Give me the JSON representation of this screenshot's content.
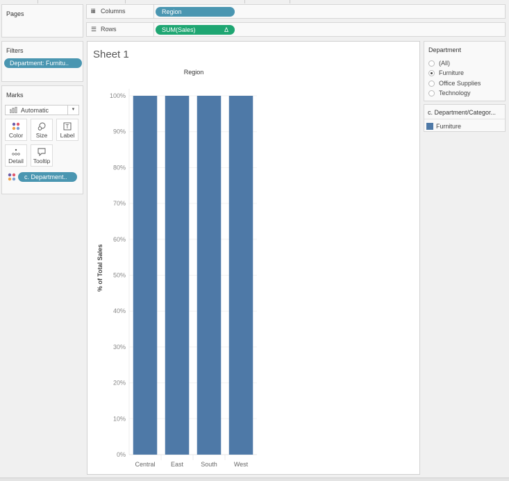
{
  "pages": {
    "title": "Pages"
  },
  "shelves": {
    "columns": {
      "label": "Columns",
      "icon": "columns-icon",
      "pill": "Region"
    },
    "rows": {
      "label": "Rows",
      "icon": "rows-icon",
      "pill": "SUM(Sales)",
      "pill_badge": "Δ"
    }
  },
  "filters": {
    "title": "Filters",
    "pill": "Department: Furnitu.."
  },
  "marks": {
    "title": "Marks",
    "mark_type": "Automatic",
    "buttons": [
      {
        "label": "Color",
        "icon": "color-icon"
      },
      {
        "label": "Size",
        "icon": "size-icon"
      },
      {
        "label": "Label",
        "icon": "label-icon"
      },
      {
        "label": "Detail",
        "icon": "detail-icon"
      },
      {
        "label": "Tooltip",
        "icon": "tooltip-icon"
      }
    ],
    "color_pill": "c. Department.."
  },
  "sheet": {
    "title": "Sheet 1"
  },
  "department_filter": {
    "title": "Department",
    "options": [
      {
        "label": "(All)",
        "selected": false
      },
      {
        "label": "Furniture",
        "selected": true
      },
      {
        "label": "Office Supplies",
        "selected": false
      },
      {
        "label": "Technology",
        "selected": false
      }
    ]
  },
  "legend": {
    "title": "c. Department/Categor...",
    "items": [
      {
        "label": "Furniture",
        "color": "#4e79a7"
      }
    ]
  },
  "colors": {
    "bar": "#4e79a7",
    "pill_blue": "#4a96b1",
    "pill_green": "#1ea672"
  },
  "chart_data": {
    "type": "bar",
    "title": "",
    "header": "Region",
    "categories": [
      "Central",
      "East",
      "South",
      "West"
    ],
    "values": [
      100,
      100,
      100,
      100
    ],
    "xlabel": "",
    "ylabel": "% of Total Sales",
    "ylim": [
      0,
      100
    ],
    "yticks": [
      0,
      10,
      20,
      30,
      40,
      50,
      60,
      70,
      80,
      90,
      100
    ],
    "ytick_labels": [
      "0%",
      "10%",
      "20%",
      "30%",
      "40%",
      "50%",
      "60%",
      "70%",
      "80%",
      "90%",
      "100%"
    ],
    "grid": true,
    "legend": "none"
  }
}
